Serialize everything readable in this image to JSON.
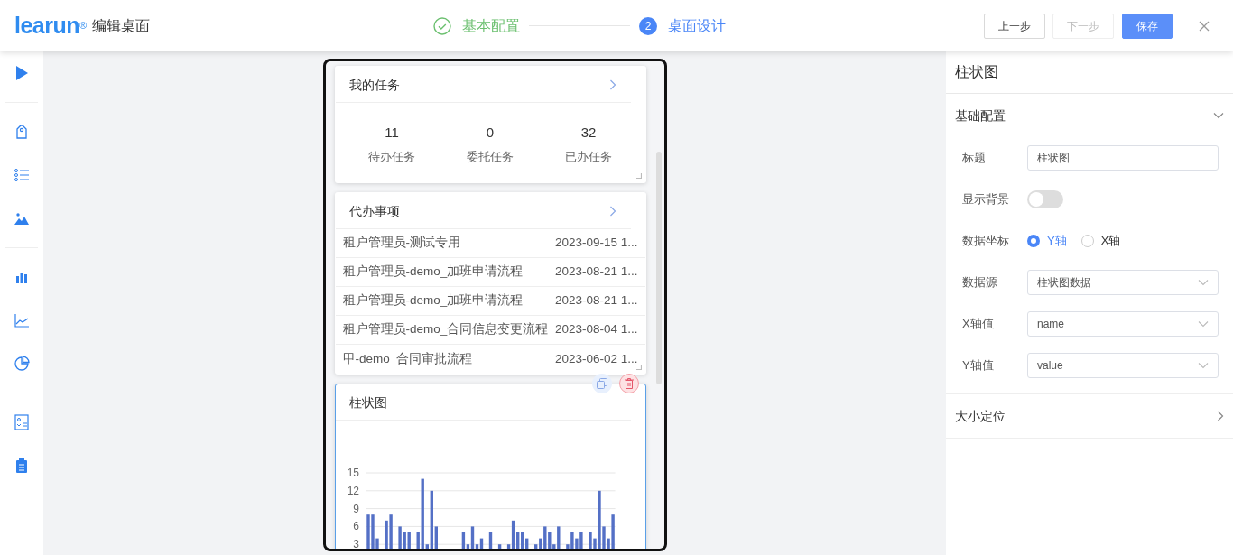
{
  "header": {
    "logo": "learun",
    "logo_mark": "®",
    "title": "编辑桌面"
  },
  "steps": [
    {
      "label": "基本配置",
      "done": true,
      "selected": false
    },
    {
      "number": "2",
      "label": "桌面设计",
      "done": false,
      "selected": true
    }
  ],
  "buttons": [
    {
      "label": "上一步",
      "kind": "default",
      "disabled": false
    },
    {
      "label": "下一步",
      "kind": "default",
      "disabled": true
    },
    {
      "label": "保存",
      "kind": "primary",
      "disabled": false
    }
  ],
  "widgets": [
    {
      "kind": "stats",
      "title": "我的任务",
      "selected": false,
      "stats": [
        {
          "value": "11",
          "label": "待办任务"
        },
        {
          "value": "0",
          "label": "委托任务"
        },
        {
          "value": "32",
          "label": "已办任务"
        }
      ]
    },
    {
      "kind": "list",
      "title": "代办事项",
      "selected": false,
      "rows": [
        {
          "name": "租户管理员-测试专用",
          "time": "2023-09-15 1..."
        },
        {
          "name": "租户管理员-demo_加班申请流程",
          "time": "2023-08-21 1..."
        },
        {
          "name": "租户管理员-demo_加班申请流程",
          "time": "2023-08-21 1..."
        },
        {
          "name": "租户管理员-demo_合同信息变更流程",
          "time": "2023-08-04 1..."
        },
        {
          "name": "甲-demo_合同审批流程",
          "time": "2023-06-02 1..."
        }
      ]
    },
    {
      "kind": "chart",
      "title": "柱状图",
      "selected": true,
      "chart_data": {
        "type": "bar",
        "grid": true,
        "ylim": [
          0,
          15
        ],
        "yticks": [
          3,
          6,
          9,
          12,
          15
        ],
        "series": [
          {
            "color": "#5470c6",
            "values": [
              8,
              8,
              4,
              null,
              7,
              8,
              null,
              6,
              5,
              5,
              null,
              5,
              14,
              3,
              12,
              6,
              null,
              null,
              null,
              null,
              null,
              5,
              3,
              6,
              3,
              4,
              null,
              5,
              null,
              3,
              null,
              3,
              7,
              5,
              5,
              4,
              null,
              3,
              4,
              6,
              5,
              3,
              6,
              null,
              3,
              5,
              4,
              5,
              null,
              5,
              4,
              12,
              6,
              4,
              8
            ]
          }
        ]
      }
    }
  ],
  "panel": {
    "title": "柱状图",
    "sections": [
      {
        "title": "基础配置",
        "expanded": true,
        "fields": [
          {
            "kind": "text",
            "label": "标题",
            "value": "柱状图"
          },
          {
            "kind": "switch",
            "label": "显示背景",
            "on": false
          },
          {
            "kind": "radio",
            "label": "数据坐标",
            "options": [
              {
                "label": "Y轴",
                "selected": true
              },
              {
                "label": "X轴",
                "selected": false
              }
            ]
          },
          {
            "kind": "select",
            "label": "数据源",
            "value": "柱状图数据"
          },
          {
            "kind": "select",
            "label": "X轴值",
            "value": "name"
          },
          {
            "kind": "select",
            "label": "Y轴值",
            "value": "value"
          }
        ]
      },
      {
        "title": "大小定位",
        "expanded": false
      }
    ]
  }
}
